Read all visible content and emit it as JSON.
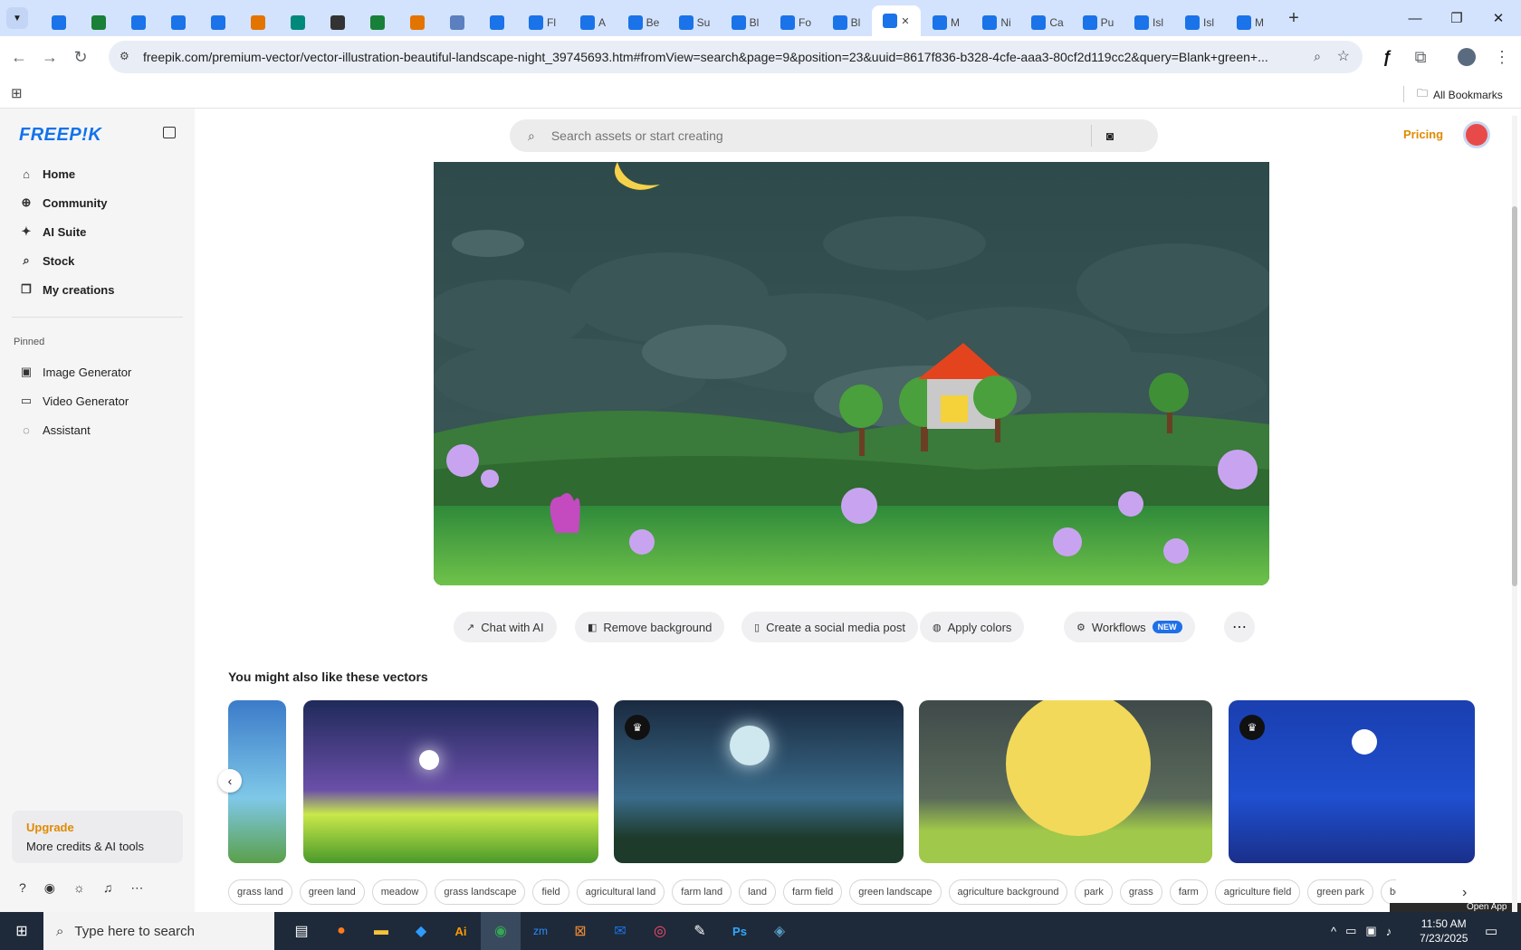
{
  "browser": {
    "tabs": [
      {
        "label": "",
        "color": "#1a73e8"
      },
      {
        "label": "",
        "color": "#188038"
      },
      {
        "label": "",
        "color": "#1a73e8"
      },
      {
        "label": "",
        "color": "#1a73e8"
      },
      {
        "label": "",
        "color": "#1a73e8"
      },
      {
        "label": "",
        "color": "#e37400"
      },
      {
        "label": "",
        "color": "#00897b"
      },
      {
        "label": "",
        "color": "#333333"
      },
      {
        "label": "",
        "color": "#188038"
      },
      {
        "label": "",
        "color": "#e37400"
      },
      {
        "label": "",
        "color": "#5b7fbf"
      },
      {
        "label": "",
        "color": "#1a73e8"
      },
      {
        "label": "Fl",
        "color": "#1a73e8"
      },
      {
        "label": "A",
        "color": "#1a73e8"
      },
      {
        "label": "Be",
        "color": "#1a73e8"
      },
      {
        "label": "Su",
        "color": "#1a73e8"
      },
      {
        "label": "Bl",
        "color": "#1a73e8"
      },
      {
        "label": "Fo",
        "color": "#1a73e8"
      },
      {
        "label": "Bl",
        "color": "#1a73e8"
      },
      {
        "label": "",
        "color": "#1a73e8",
        "active": true
      },
      {
        "label": "M",
        "color": "#1a73e8"
      },
      {
        "label": "Ni",
        "color": "#1a73e8"
      },
      {
        "label": "Ca",
        "color": "#1a73e8"
      },
      {
        "label": "Pu",
        "color": "#1a73e8"
      },
      {
        "label": "Isl",
        "color": "#1a73e8"
      },
      {
        "label": "Isl",
        "color": "#1a73e8"
      },
      {
        "label": "M",
        "color": "#1a73e8"
      }
    ],
    "url": "freepik.com/premium-vector/vector-illustration-beautiful-landscape-night_39745693.htm#fromView=search&page=9&position=23&uuid=8617f836-b328-4cfe-aaa3-80cf2d119cc2&query=Blank+green+...",
    "all_bookmarks": "All Bookmarks"
  },
  "sidebar": {
    "logo": "FREEP!K",
    "nav": [
      {
        "label": "Home",
        "icon": "home-icon"
      },
      {
        "label": "Community",
        "icon": "globe-icon"
      },
      {
        "label": "AI Suite",
        "icon": "sparkle-icon"
      },
      {
        "label": "Stock",
        "icon": "search-icon"
      },
      {
        "label": "My creations",
        "icon": "folder-icon"
      }
    ],
    "pinned_heading": "Pinned",
    "pinned": [
      {
        "label": "Image Generator",
        "icon": "image-icon"
      },
      {
        "label": "Video Generator",
        "icon": "video-icon"
      },
      {
        "label": "Assistant",
        "icon": "chat-icon"
      }
    ],
    "upgrade": {
      "title": "Upgrade",
      "subtitle": "More credits & AI tools"
    }
  },
  "header": {
    "search_placeholder": "Search assets or start creating",
    "pricing": "Pricing"
  },
  "actions": [
    {
      "label": "Chat with AI"
    },
    {
      "label": "Remove background"
    },
    {
      "label": "Create a social media post"
    },
    {
      "label": "Apply colors"
    },
    {
      "label": "Workflows",
      "badge": "NEW"
    }
  ],
  "related_heading": "You might also like these vectors",
  "tags": [
    "grass land",
    "green land",
    "meadow",
    "grass landscape",
    "field",
    "agricultural land",
    "farm land",
    "land",
    "farm field",
    "green landscape",
    "agriculture background",
    "park",
    "grass",
    "farm",
    "agriculture field",
    "green park",
    "be"
  ],
  "taskbar": {
    "search_placeholder": "Type here to search",
    "time": "11:50 AM",
    "date": "7/23/2025",
    "open_app": "Open App"
  }
}
